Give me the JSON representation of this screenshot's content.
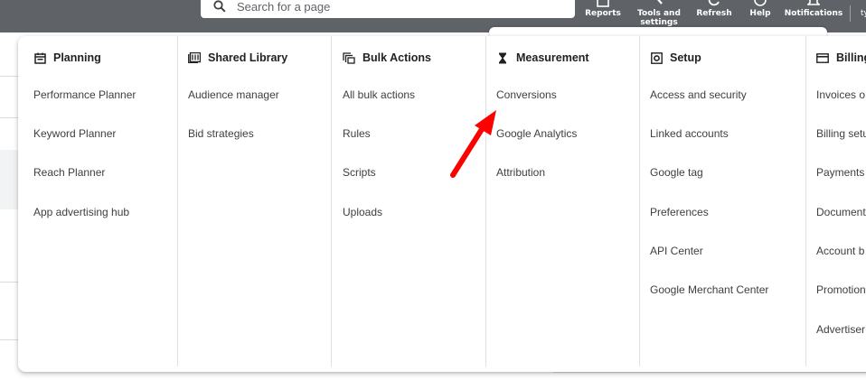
{
  "topbar": {
    "search_placeholder": "Search for a page",
    "buttons": [
      {
        "label": "Reports",
        "icon": "reports-icon"
      },
      {
        "label": "Tools and settings",
        "icon": "wrench-icon"
      },
      {
        "label": "Refresh",
        "icon": "refresh-icon"
      },
      {
        "label": "Help",
        "icon": "help-icon"
      },
      {
        "label": "Notifications",
        "icon": "bell-icon"
      }
    ],
    "account_initial": "ty"
  },
  "menu": {
    "columns": [
      {
        "title": "Planning",
        "icon": "calendar-icon",
        "items": [
          "Performance Planner",
          "Keyword Planner",
          "Reach Planner",
          "App advertising hub"
        ]
      },
      {
        "title": "Shared Library",
        "icon": "library-icon",
        "items": [
          "Audience manager",
          "Bid strategies"
        ]
      },
      {
        "title": "Bulk Actions",
        "icon": "copy-icon",
        "items": [
          "All bulk actions",
          "Rules",
          "Scripts",
          "Uploads"
        ]
      },
      {
        "title": "Measurement",
        "icon": "hourglass-icon",
        "items": [
          "Conversions",
          "Google Analytics",
          "Attribution"
        ]
      },
      {
        "title": "Setup",
        "icon": "setup-icon",
        "items": [
          "Access and security",
          "Linked accounts",
          "Google tag",
          "Preferences",
          "API Center",
          "Google Merchant Center"
        ]
      },
      {
        "title": "Billing",
        "icon": "credit-card-icon",
        "items": [
          "Invoices o",
          "Billing setu",
          "Payments",
          "Document",
          "Account b",
          "Promotion",
          "Advertiser"
        ]
      }
    ]
  },
  "annotation": {
    "arrow_color": "#ff0000",
    "points_to": "Conversions"
  }
}
